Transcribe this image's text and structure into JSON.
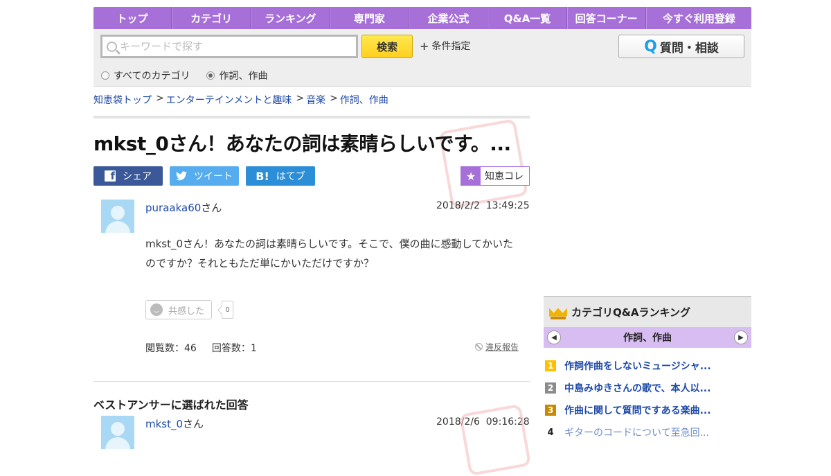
{
  "nav": {
    "tabs": [
      "トップ",
      "カテゴリ",
      "ランキング",
      "専門家",
      "企業公式",
      "Q&A一覧",
      "回答コーナー",
      "今すぐ利用登録"
    ]
  },
  "search": {
    "placeholder": "キーワードで探す",
    "button": "検索",
    "condition": "条件指定",
    "ask_button": "質問・相談",
    "ask_icon": "Q",
    "radio_all": "すべてのカテゴリ",
    "radio_current": "作詞、作曲"
  },
  "breadcrumb": [
    "知恵袋トップ",
    "エンターテインメントと趣味",
    "音楽",
    "作詞、作曲"
  ],
  "breadcrumb_sep": ">",
  "question": {
    "title": "mkst_0さん！あなたの詞は素晴らしいです。...",
    "user": "puraaka60",
    "honorific": "さん",
    "date": "2018/2/2  13:49:25",
    "body": "mkst_0さん！あなたの詞は素晴らしいです。そこで、僕の曲に感動してかいたのですか？それともただ単にかいただけですか？",
    "empathy_label": "共感した",
    "empathy_count": "0",
    "views_label": "閲覧数：46",
    "answers_label": "回答数：1",
    "report": "違反報告"
  },
  "share": {
    "facebook": "シェア",
    "twitter": "ツイート",
    "hatena": "はてブ",
    "hatena_icon": "B!",
    "chiecoll": "知恵コレ"
  },
  "best_answer": {
    "heading": "ベストアンサーに選ばれた回答",
    "user": "mkst_0",
    "honorific": "さん",
    "date": "2018/2/6  09:16:28"
  },
  "ranking": {
    "title": "カテゴリQ&Aランキング",
    "category": "作詞、作曲",
    "items": [
      {
        "rank": "1",
        "text": "作詞作曲をしないミュージシャ..."
      },
      {
        "rank": "2",
        "text": "中島みゆきさんの歌で、本人以..."
      },
      {
        "rank": "3",
        "text": "作曲に関して質問ですある楽曲..."
      },
      {
        "rank": "4",
        "text": "ギターのコードについて至急回..."
      }
    ]
  },
  "colors": {
    "nav": "#a770d9",
    "search_button": "#ffd82e",
    "link": "#1d49a7",
    "facebook": "#3b5998",
    "twitter": "#55acee",
    "hatena": "#2c8ed7"
  }
}
